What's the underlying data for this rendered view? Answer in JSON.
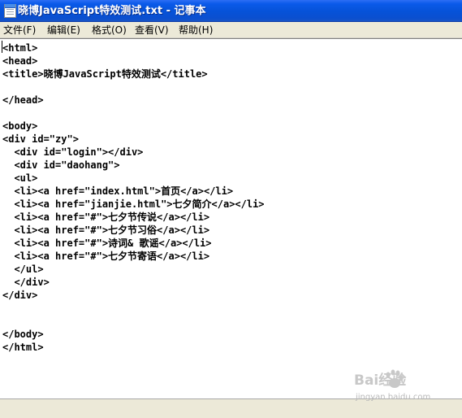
{
  "window": {
    "title": "晓博JavaScript特效测试.txt - 记事本",
    "app_icon": "notepad-icon"
  },
  "menu": [
    {
      "label": "文件(F)"
    },
    {
      "label": "编辑(E)"
    },
    {
      "label": "格式(O)"
    },
    {
      "label": "查看(V)"
    },
    {
      "label": "帮助(H)"
    }
  ],
  "editor": {
    "lines": [
      "<html>",
      "<head>",
      "<title>晓博JavaScript特效测试</title>",
      "",
      "</head>",
      "",
      "<body>",
      "<div id=\"zy\">",
      "  <div id=\"login\"></div>",
      "  <div id=\"daohang\">",
      "  <ul>",
      "  <li><a href=\"index.html\">首页</a></li>",
      "  <li><a href=\"jianjie.html\">七夕简介</a></li>",
      "  <li><a href=\"#\">七夕节传说</a></li>",
      "  <li><a href=\"#\">七夕节习俗</a></li>",
      "  <li><a href=\"#\">诗词& 歌谣</a></li>",
      "  <li><a href=\"#\">七夕节寄语</a></li>",
      "  </ul>",
      "  </div>",
      "</div>",
      "",
      "",
      "</body>",
      "</html>"
    ]
  },
  "watermark": {
    "logo": "Bai经验",
    "url": "jingyan.baidu.com",
    "icon": "baidu-paw-icon"
  },
  "colors": {
    "titlebar": "#0a5ae9",
    "menubar": "#ece9d8",
    "editor_bg": "#ffffff",
    "watermark": "#c8c8c8"
  }
}
